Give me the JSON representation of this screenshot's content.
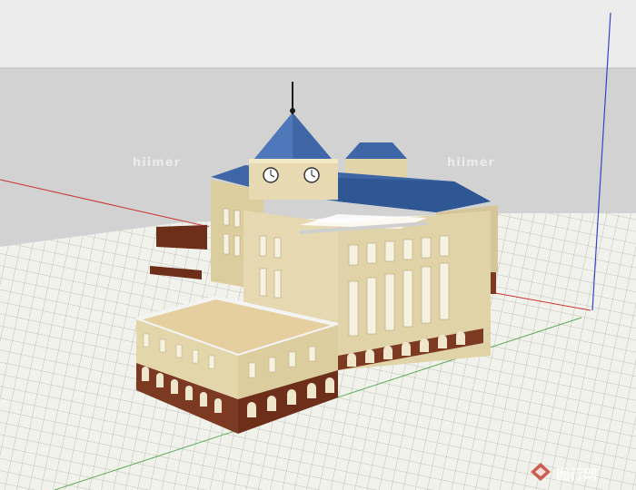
{
  "scene": {
    "subject": "3D model of a European-style building with clock tower and blue roofs",
    "colors": {
      "sky": "#e9e9e9",
      "horizon_band": "#d0d0d0",
      "ground_grid": "#f0f0ea",
      "grid_line": "#b9b9b3",
      "facade": "#e6d9b1",
      "facade_shade": "#d8c89a",
      "roof_blue": "#3f67a8",
      "roof_blue_dark": "#2f4f86",
      "base_brick": "#7d3a22",
      "terrace": "#e6cf9f",
      "axis_red": "#cc3333",
      "axis_blue": "#3344cc",
      "axis_green": "#3a9a3a"
    },
    "clock_icon": "clock-icon"
  },
  "watermarks": {
    "left": "hiimer",
    "right": "hiimer",
    "corner": "图行网"
  }
}
